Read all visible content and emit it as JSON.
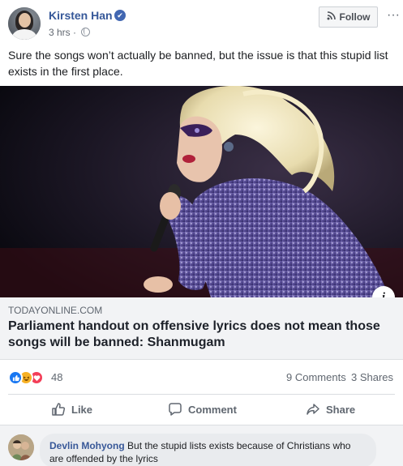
{
  "post": {
    "author": "Kirsten Han",
    "time": "3 hrs",
    "separator": "·",
    "verified_glyph": "✔",
    "follow_label": "Follow",
    "menu_glyph": "···",
    "text": "Sure the songs won’t actually be banned, but the issue is that this stupid list exists in the first place."
  },
  "link_preview": {
    "domain": "TODAYONLINE.COM",
    "headline": "Parliament handout on offensive lyrics does not mean those songs will be banned: Shanmugam",
    "info_glyph": "i"
  },
  "stats": {
    "reaction_icons": [
      "like-icon",
      "haha-icon",
      "love-icon"
    ],
    "reaction_count": "48",
    "comments": "9 Comments",
    "shares": "3 Shares"
  },
  "actions": {
    "like": "Like",
    "comment": "Comment",
    "share": "Share"
  },
  "comment": {
    "author": "Devlin Mohyong",
    "text": "But the stupid lists exists because of Christians who are offended by the lyrics"
  },
  "colors": {
    "link_blue": "#365899",
    "accent_blue": "#4267b2",
    "muted_text": "#606770",
    "link_box_bg": "#f2f3f5"
  }
}
